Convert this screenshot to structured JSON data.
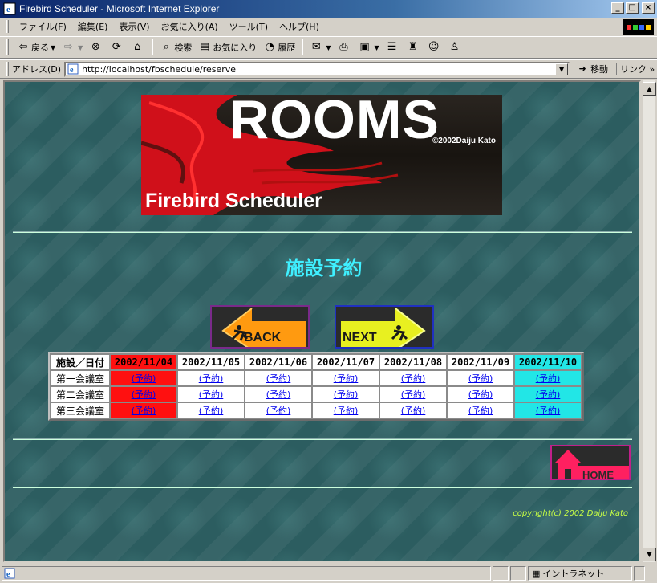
{
  "window": {
    "title": "Firebird Scheduler - Microsoft Internet Explorer",
    "buttons": [
      "_",
      "□",
      "×"
    ]
  },
  "menu": [
    "ファイル(F)",
    "編集(E)",
    "表示(V)",
    "お気に入り(A)",
    "ツール(T)",
    "ヘルプ(H)"
  ],
  "toolbar": {
    "back": "戻る",
    "search": "検索",
    "favorites": "お気に入り",
    "history": "履歴"
  },
  "address": {
    "label": "アドレス(D)",
    "url": "http://localhost/fbschedule/reserve",
    "go": "移動",
    "links": "リンク »"
  },
  "banner": {
    "title": "ROOMS",
    "copyright": "©2002Daiju Kato",
    "subtitle": "Firebird Scheduler"
  },
  "page": {
    "heading": "施設予約",
    "back_label": "BACK",
    "next_label": "NEXT",
    "home_label": "HOME",
    "copyright": "copyright(c) 2002 Daiju Kato"
  },
  "schedule": {
    "corner": "施設／日付",
    "dates": [
      "2002/11/04",
      "2002/11/05",
      "2002/11/06",
      "2002/11/07",
      "2002/11/08",
      "2002/11/09",
      "2002/11/10"
    ],
    "rooms": [
      "第一会議室",
      "第二会議室",
      "第三会議室"
    ],
    "link_label": "(予約)"
  },
  "colors": {
    "today": "#ff1010",
    "sunday": "#22e6e6",
    "heading": "#3ff0ff",
    "copyright": "#c8ff44"
  },
  "status": {
    "zone": "イントラネット"
  }
}
